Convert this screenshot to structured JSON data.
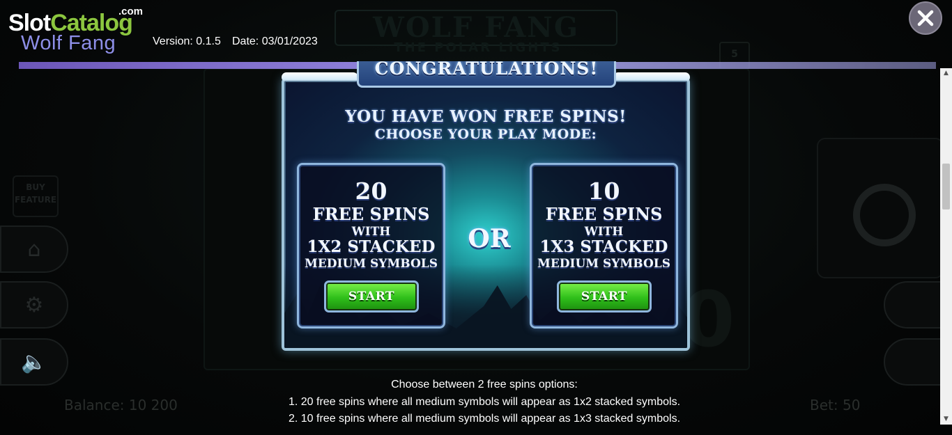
{
  "branding": {
    "logo_slot": "Slot",
    "logo_catalog": "Catalog",
    "logo_com": ".com",
    "game_name": "Wolf Fang"
  },
  "header": {
    "version_label": "Version: 0.1.5",
    "date_label": "Date: 03/01/2023"
  },
  "background_game": {
    "title": "WOLF FANG",
    "subtitle": "THE POLAR LIGHTS",
    "balance_label": "Balance: 10 200",
    "bet_label": "Bet: 50",
    "big_digit": "0"
  },
  "dialog": {
    "banner": "CONGRATULATIONS!",
    "headline": "YOU HAVE WON FREE SPINS!",
    "subheadline": "CHOOSE YOUR PLAY MODE:",
    "or_label": "OR",
    "options": [
      {
        "spins": "20",
        "line1": "FREE SPINS",
        "line2": "WITH",
        "line3": "1X2 STACKED",
        "line4": "MEDIUM SYMBOLS",
        "button_label": "START"
      },
      {
        "spins": "10",
        "line1": "FREE SPINS",
        "line2": "WITH",
        "line3": "1X3 STACKED",
        "line4": "MEDIUM SYMBOLS",
        "button_label": "START"
      }
    ]
  },
  "description": {
    "intro": "Choose between 2 free spins options:",
    "items": [
      "1. 20 free spins where all medium symbols will appear as 1x2 stacked symbols.",
      "2. 10 free spins where all medium symbols will appear as 1x3 stacked symbols."
    ]
  },
  "icons": {
    "close": "close-icon",
    "home": "home-icon",
    "settings": "gear-icon",
    "sound": "speaker-icon"
  },
  "colors": {
    "brand_green": "#8cc63f",
    "game_name_purple": "#8e8fe8",
    "start_button_green": "#2fbf1a",
    "dialog_border": "#9ec3d9"
  }
}
